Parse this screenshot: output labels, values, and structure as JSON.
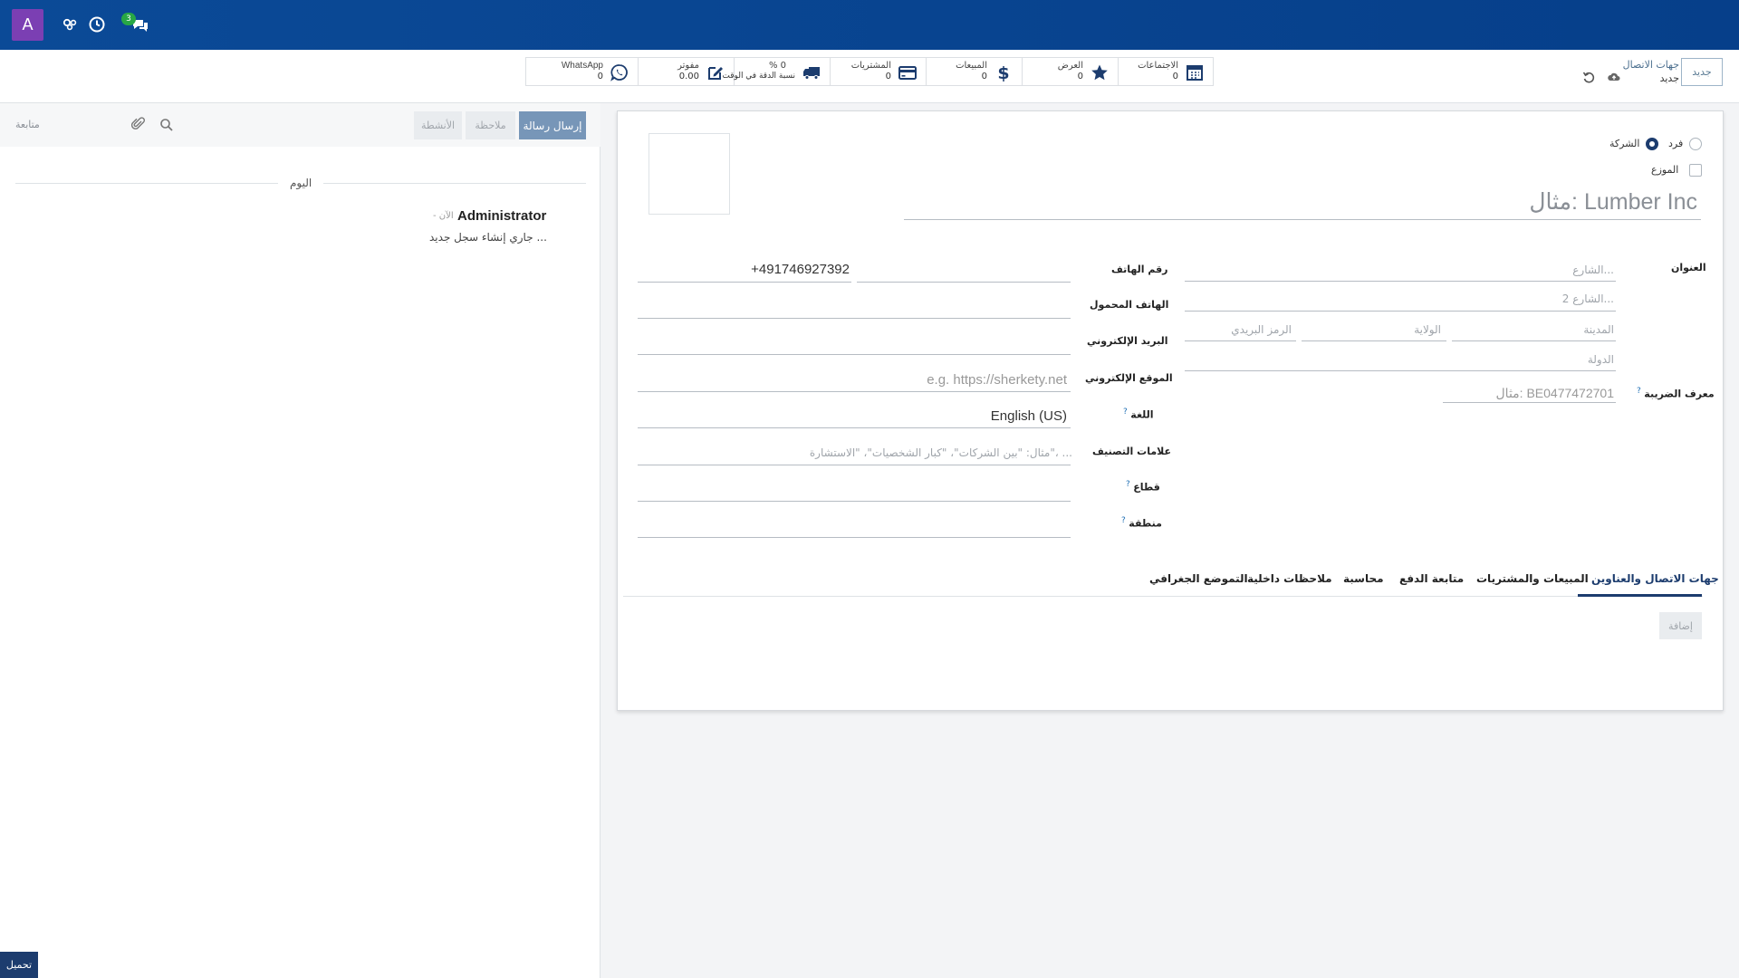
{
  "navbar": {
    "avatar_letter": "A",
    "messages_count": "3"
  },
  "control_panel": {
    "new_button": "جديد",
    "breadcrumb_parent": "جهات الاتصال",
    "breadcrumb_current": "جديد"
  },
  "stats": [
    {
      "label": "الاجتماعات",
      "value": "0",
      "icon": "calendar-icon"
    },
    {
      "label": "العرض",
      "value": "0",
      "icon": "star-icon"
    },
    {
      "label": "المبيعات",
      "value": "0",
      "icon": "dollar-icon"
    },
    {
      "label": "المشتريات",
      "value": "0",
      "icon": "credit-card-icon"
    },
    {
      "label": "% 0",
      "value": "نسبة الدقة في الوقت",
      "icon": "truck-icon"
    },
    {
      "label": "مفوتر",
      "value": "0.00",
      "icon": "edit-icon"
    },
    {
      "label": "WhatsApp",
      "value": "0",
      "icon": "whatsapp-icon"
    }
  ],
  "form": {
    "radio_individual": "فرد",
    "radio_company": "الشركة",
    "distributor_label": "الموزع",
    "name_placeholder": "مثال: Lumber Inc",
    "address_label": "العنوان",
    "street_placeholder": "الشارع...",
    "street2_placeholder": "الشارع 2...",
    "city_placeholder": "المدينة",
    "state_placeholder": "الولاية",
    "zip_placeholder": "الرمز البريدي",
    "country_placeholder": "الدولة",
    "vat_label": "معرف الضريبة",
    "vat_placeholder": "مثال: BE0477472701",
    "phone_label": "رقم الهاتف",
    "phone_value": "+491746927392",
    "mobile_label": "الهاتف المحمول",
    "email_label": "البريد الإلكتروني",
    "website_label": "الموقع الإلكتروني",
    "website_placeholder": "e.g. https://sherkety.net",
    "language_label": "اللغة",
    "language_value": "English (US)",
    "tags_label": "علامات التصنيف",
    "tags_placeholder": "مثال: \"بين الشركات\"، \"كبار الشخصيات\"، \"الاستشارة\"، ...",
    "industry_label": "قطاع",
    "region_label": "منطقة",
    "help_mark": "?"
  },
  "tabs": [
    "جهات الاتصال والعناوين",
    "المبيعات والمشتريات",
    "متابعة الدفع",
    "محاسبة",
    "ملاحظات داخلية",
    "التموضع الجغرافي"
  ],
  "add_button": "إضافة",
  "chatter": {
    "send_message": "إرسال رسالة",
    "log_note": "ملاحظة",
    "activities": "الأنشطة",
    "follow": "متابعة",
    "today": "اليوم",
    "author": "Administrator",
    "time_ago": "- الآن",
    "message": "جاري إنشاء سجل جديد ..."
  },
  "footer": {
    "download": "تحميل"
  }
}
